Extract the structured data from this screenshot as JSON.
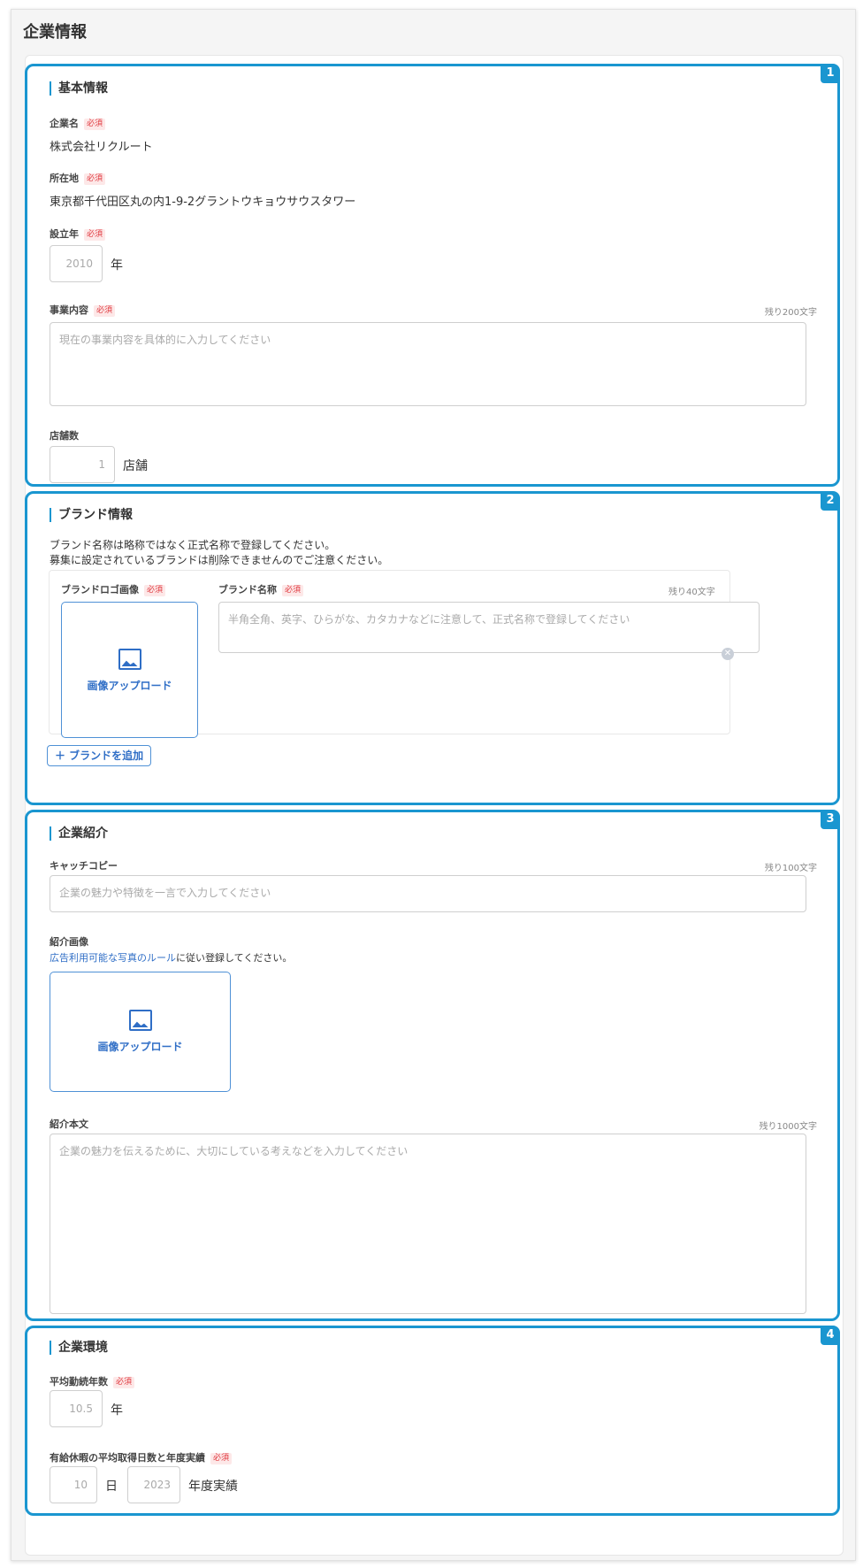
{
  "page": {
    "title": "企業情報"
  },
  "common": {
    "required": "必須"
  },
  "basic": {
    "number": "1",
    "title": "基本情報",
    "company_name_label": "企業名",
    "company_name_value": "株式会社リクルート",
    "address_label": "所在地",
    "address_value": "東京都千代田区丸の内1-9-2グラントウキョウサウスタワー",
    "founded_label": "設立年",
    "founded_placeholder": "2010",
    "founded_unit": "年",
    "business_label": "事業内容",
    "business_counter": "残り200文字",
    "business_placeholder": "現在の事業内容を具体的に入力してください",
    "stores_label": "店舗数",
    "stores_placeholder": "1",
    "stores_unit": "店舗"
  },
  "brand": {
    "number": "2",
    "title": "ブランド情報",
    "note_line1": "ブランド名称は略称ではなく正式名称で登録してください。",
    "note_line2": "募集に設定されているブランドは削除できませんのでご注意ください。",
    "logo_label": "ブランドロゴ画像",
    "upload_label": "画像アップロード",
    "name_label": "ブランド名称",
    "name_counter": "残り40文字",
    "name_placeholder": "半角全角、英字、ひらがな、カタカナなどに注意して、正式名称で登録してください",
    "clear_glyph": "✕",
    "add_label": "＋ ブランドを追加"
  },
  "intro": {
    "number": "3",
    "title": "企業紹介",
    "catch_label": "キャッチコピー",
    "catch_counter": "残り100文字",
    "catch_placeholder": "企業の魅力や特徴を一言で入力してください",
    "image_label": "紹介画像",
    "rule_link": "広告利用可能な写真のルール",
    "rule_suffix": "に従い登録してください。",
    "upload_label": "画像アップロード",
    "body_label": "紹介本文",
    "body_counter": "残り1000文字",
    "body_placeholder": "企業の魅力を伝えるために、大切にしている考えなどを入力してください"
  },
  "env": {
    "number": "4",
    "title": "企業環境",
    "tenure_label": "平均勤続年数",
    "tenure_placeholder": "10.5",
    "tenure_unit": "年",
    "leave_label": "有給休暇の平均取得日数と年度実績",
    "leave_days_placeholder": "10",
    "leave_days_unit": "日",
    "leave_year_placeholder": "2023",
    "leave_year_unit": "年度実績"
  }
}
